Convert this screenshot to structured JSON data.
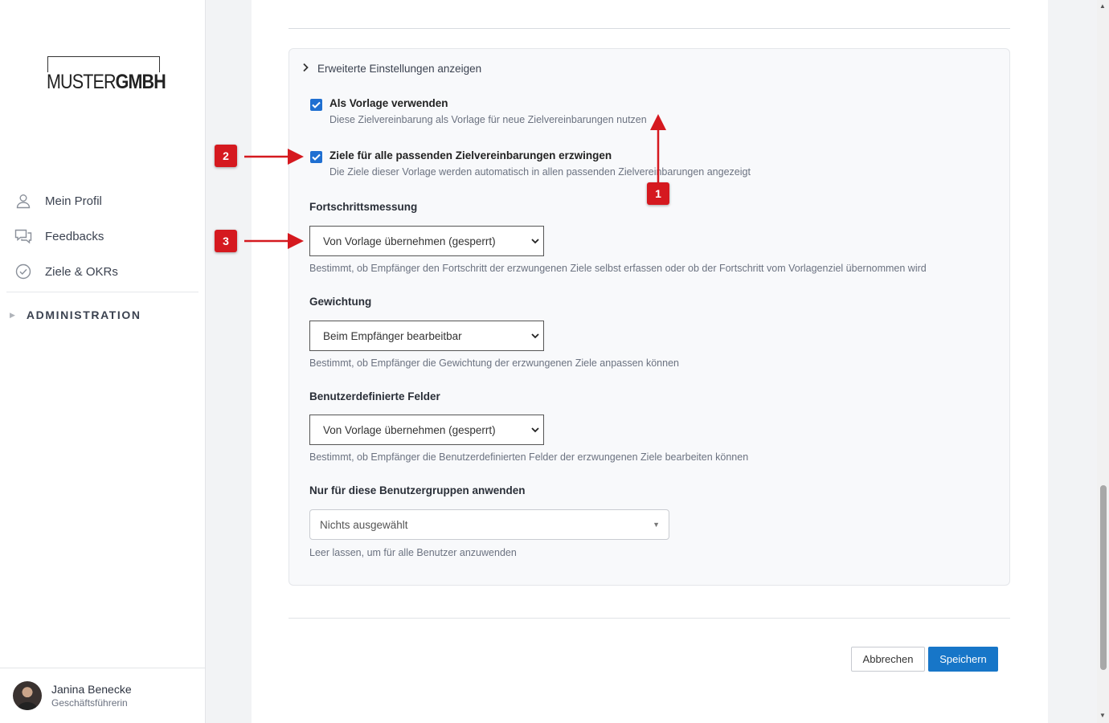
{
  "sidebar": {
    "logo": {
      "part1": "MUSTER",
      "part2": "GMBH"
    },
    "items": [
      {
        "label": "Mein Profil",
        "icon": "user-icon"
      },
      {
        "label": "Feedbacks",
        "icon": "chat-icon"
      },
      {
        "label": "Ziele & OKRs",
        "icon": "check-circle-icon"
      }
    ],
    "admin_label": "ADMINISTRATION",
    "user": {
      "name": "Janina Benecke",
      "role": "Geschäftsführerin"
    }
  },
  "settings": {
    "advanced_toggle": "Erweiterte Einstellungen anzeigen",
    "as_template": {
      "title": "Als Vorlage verwenden",
      "desc": "Diese Zielvereinbarung als Vorlage für neue Zielvereinbarungen nutzen",
      "checked": true
    },
    "enforce_goals": {
      "title": "Ziele für alle passenden Zielvereinbarungen erzwingen",
      "desc": "Die Ziele dieser Vorlage werden automatisch in allen passenden Zielvereinbarungen angezeigt",
      "checked": true
    },
    "progress": {
      "label": "Fortschrittsmessung",
      "value": "Von Vorlage übernehmen (gesperrt)",
      "help": "Bestimmt, ob Empfänger den Fortschritt der erzwungenen Ziele selbst erfassen oder ob der Fortschritt vom Vorlagenziel übernommen wird"
    },
    "weighting": {
      "label": "Gewichtung",
      "value": "Beim Empfänger bearbeitbar",
      "help": "Bestimmt, ob Empfänger die Gewichtung der erzwungenen Ziele anpassen können"
    },
    "custom_fields": {
      "label": "Benutzerdefinierte Felder",
      "value": "Von Vorlage übernehmen (gesperrt)",
      "help": "Bestimmt, ob Empfänger die Benutzerdefinierten Felder der erzwungenen Ziele bearbeiten können"
    },
    "user_groups": {
      "label": "Nur für diese Benutzergruppen anwenden",
      "placeholder": "Nichts ausgewählt",
      "help": "Leer lassen, um für alle Benutzer anzuwenden"
    }
  },
  "actions": {
    "cancel": "Abbrechen",
    "save": "Speichern"
  },
  "annotations": {
    "badge1": "1",
    "badge2": "2",
    "badge3": "3",
    "color": "#d5191f"
  }
}
